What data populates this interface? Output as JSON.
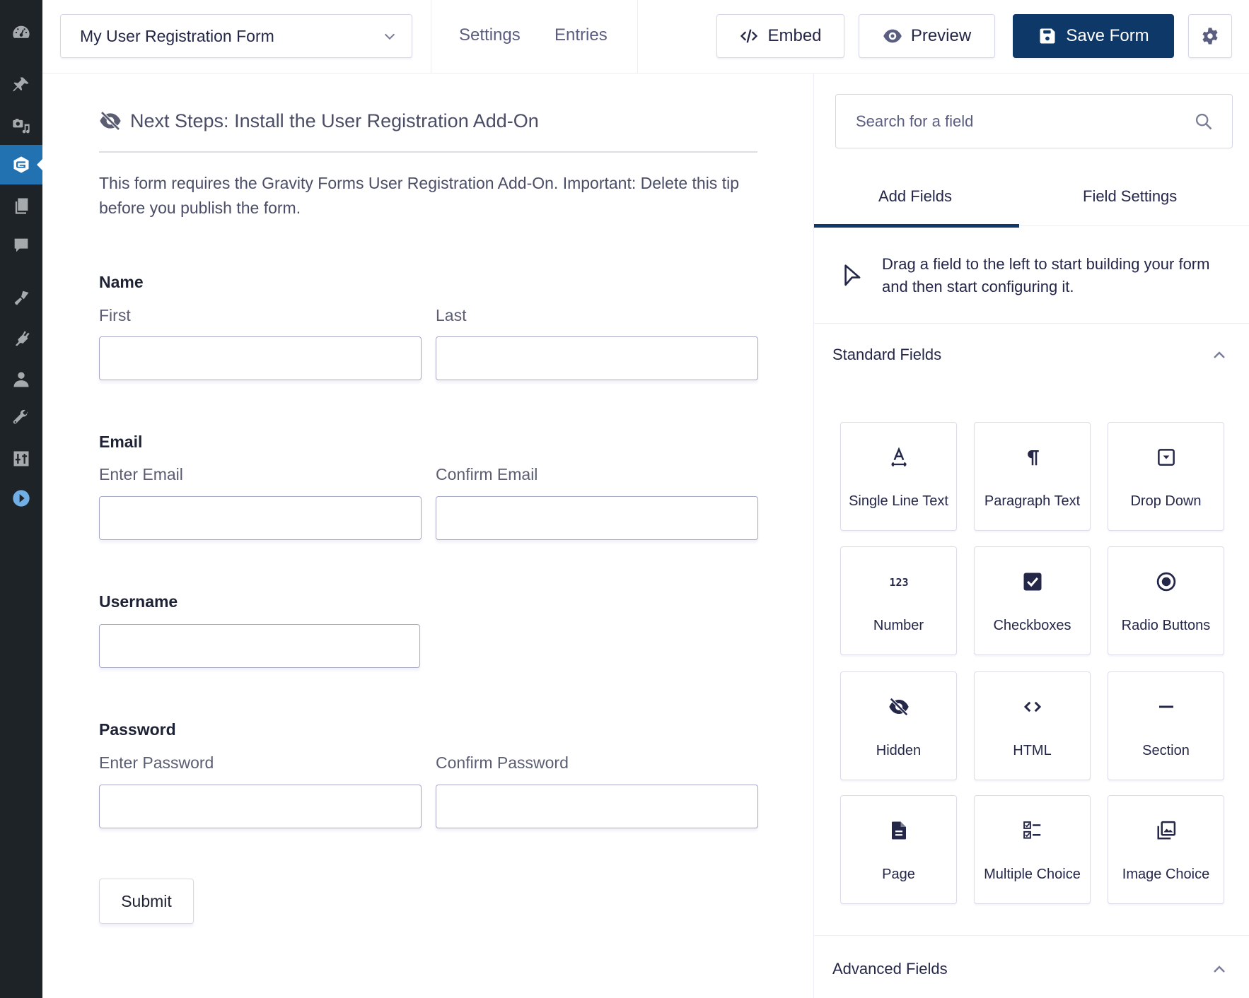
{
  "sidebar": {
    "items": [
      {
        "icon": "dashboard-icon"
      },
      {
        "icon": "pin-icon"
      },
      {
        "icon": "media-icon"
      },
      {
        "icon": "gravity-forms-icon",
        "active": true
      },
      {
        "icon": "pages-icon"
      },
      {
        "icon": "comments-icon"
      },
      {
        "icon": "appearance-icon"
      },
      {
        "icon": "plugins-icon"
      },
      {
        "icon": "users-icon"
      },
      {
        "icon": "tools-icon"
      },
      {
        "icon": "settings-icon"
      },
      {
        "icon": "play-icon"
      }
    ],
    "colors": {
      "background": "#1d2327",
      "active": "#2271b1"
    }
  },
  "toolbar": {
    "form_name": "My User Registration Form",
    "nav": {
      "settings": "Settings",
      "entries": "Entries"
    },
    "embed_label": "Embed",
    "preview_label": "Preview",
    "save_label": "Save Form",
    "primary_color": "#0e3868"
  },
  "canvas": {
    "tip": {
      "title": "Next Steps: Install the User Registration Add-On",
      "text": "This form requires the Gravity Forms User Registration Add-On. Important: Delete this tip before you publish the form."
    },
    "fields": {
      "name": {
        "label": "Name",
        "first": "First",
        "last": "Last"
      },
      "email": {
        "label": "Email",
        "enter": "Enter Email",
        "confirm": "Confirm Email"
      },
      "username": {
        "label": "Username"
      },
      "password": {
        "label": "Password",
        "enter": "Enter Password",
        "confirm": "Confirm Password"
      }
    },
    "submit_label": "Submit"
  },
  "panel": {
    "search_placeholder": "Search for a field",
    "tabs": {
      "add_fields": "Add Fields",
      "field_settings": "Field Settings"
    },
    "drag_hint": "Drag a field to the left to start building your form and then start configuring it.",
    "standard_title": "Standard Fields",
    "advanced_title": "Advanced Fields",
    "standard_fields": [
      {
        "label": "Single Line Text",
        "icon": "single-line-text-icon"
      },
      {
        "label": "Paragraph Text",
        "icon": "paragraph-icon"
      },
      {
        "label": "Drop Down",
        "icon": "dropdown-icon"
      },
      {
        "label": "Number",
        "icon": "number-icon"
      },
      {
        "label": "Checkboxes",
        "icon": "checkbox-icon"
      },
      {
        "label": "Radio Buttons",
        "icon": "radio-icon"
      },
      {
        "label": "Hidden",
        "icon": "hidden-icon"
      },
      {
        "label": "HTML",
        "icon": "html-icon"
      },
      {
        "label": "Section",
        "icon": "section-icon"
      },
      {
        "label": "Page",
        "icon": "page-icon"
      },
      {
        "label": "Multiple Choice",
        "icon": "multiple-choice-icon"
      },
      {
        "label": "Image Choice",
        "icon": "image-choice-icon"
      }
    ]
  }
}
